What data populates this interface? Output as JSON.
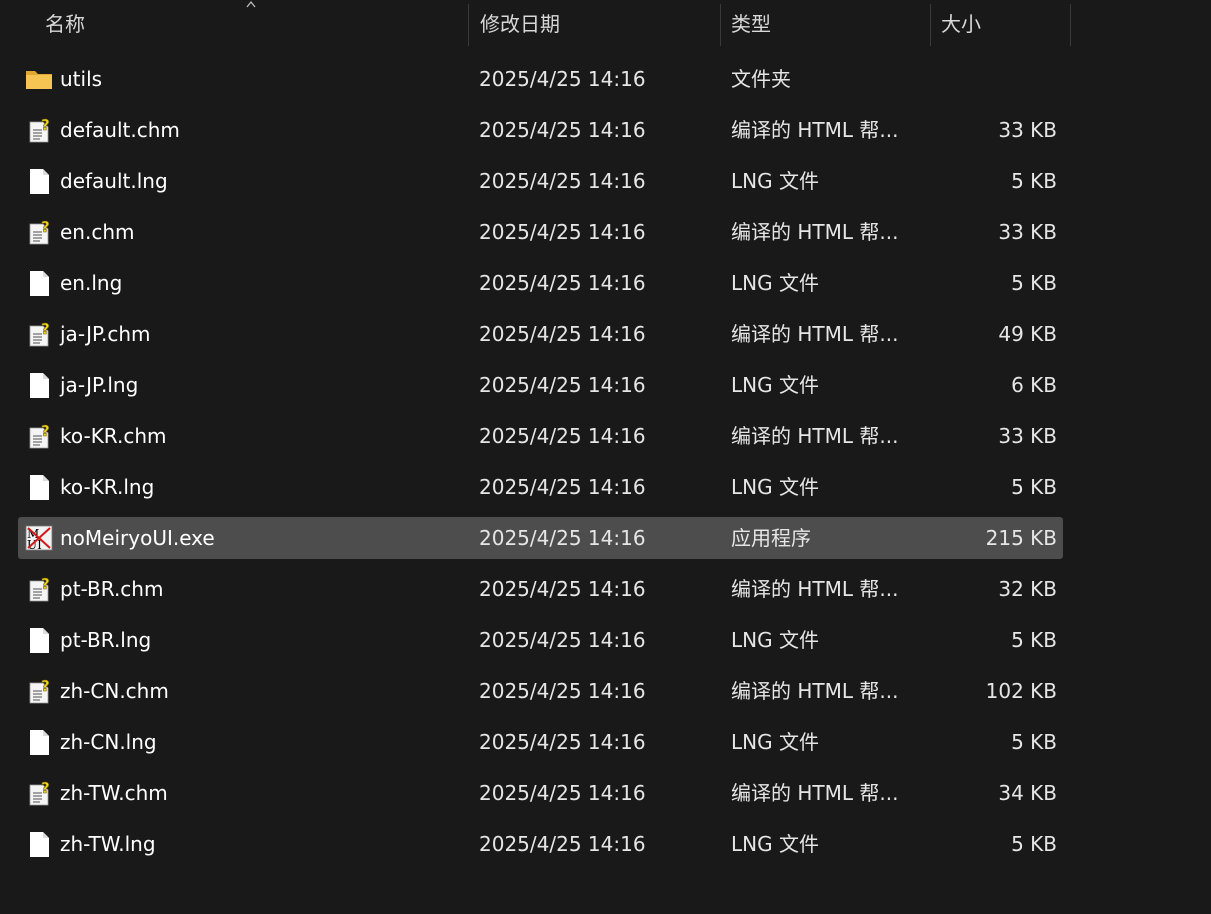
{
  "header": {
    "name": "名称",
    "date": "修改日期",
    "type": "类型",
    "size": "大小"
  },
  "colors": {
    "background": "#191919",
    "selected_row": "#4d4d4d",
    "folder": "#f2c14e",
    "help_badge": "#f7d51d"
  },
  "files": [
    {
      "name": "utils",
      "date": "2025/4/25 14:16",
      "type": "文件夹",
      "size": "",
      "icon": "folder-icon",
      "selected": false
    },
    {
      "name": "default.chm",
      "date": "2025/4/25 14:16",
      "type": "编译的 HTML 帮...",
      "size": "33 KB",
      "icon": "chm-help-icon",
      "selected": false
    },
    {
      "name": "default.lng",
      "date": "2025/4/25 14:16",
      "type": "LNG 文件",
      "size": "5 KB",
      "icon": "blank-file-icon",
      "selected": false
    },
    {
      "name": "en.chm",
      "date": "2025/4/25 14:16",
      "type": "编译的 HTML 帮...",
      "size": "33 KB",
      "icon": "chm-help-icon",
      "selected": false
    },
    {
      "name": "en.lng",
      "date": "2025/4/25 14:16",
      "type": "LNG 文件",
      "size": "5 KB",
      "icon": "blank-file-icon",
      "selected": false
    },
    {
      "name": "ja-JP.chm",
      "date": "2025/4/25 14:16",
      "type": "编译的 HTML 帮...",
      "size": "49 KB",
      "icon": "chm-help-icon",
      "selected": false
    },
    {
      "name": "ja-JP.lng",
      "date": "2025/4/25 14:16",
      "type": "LNG 文件",
      "size": "6 KB",
      "icon": "blank-file-icon",
      "selected": false
    },
    {
      "name": "ko-KR.chm",
      "date": "2025/4/25 14:16",
      "type": "编译的 HTML 帮...",
      "size": "33 KB",
      "icon": "chm-help-icon",
      "selected": false
    },
    {
      "name": "ko-KR.lng",
      "date": "2025/4/25 14:16",
      "type": "LNG 文件",
      "size": "5 KB",
      "icon": "blank-file-icon",
      "selected": false
    },
    {
      "name": "noMeiryoUI.exe",
      "date": "2025/4/25 14:16",
      "type": "应用程序",
      "size": "215 KB",
      "icon": "app-exe-icon",
      "selected": true
    },
    {
      "name": "pt-BR.chm",
      "date": "2025/4/25 14:16",
      "type": "编译的 HTML 帮...",
      "size": "32 KB",
      "icon": "chm-help-icon",
      "selected": false
    },
    {
      "name": "pt-BR.lng",
      "date": "2025/4/25 14:16",
      "type": "LNG 文件",
      "size": "5 KB",
      "icon": "blank-file-icon",
      "selected": false
    },
    {
      "name": "zh-CN.chm",
      "date": "2025/4/25 14:16",
      "type": "编译的 HTML 帮...",
      "size": "102 KB",
      "icon": "chm-help-icon",
      "selected": false
    },
    {
      "name": "zh-CN.lng",
      "date": "2025/4/25 14:16",
      "type": "LNG 文件",
      "size": "5 KB",
      "icon": "blank-file-icon",
      "selected": false
    },
    {
      "name": "zh-TW.chm",
      "date": "2025/4/25 14:16",
      "type": "编译的 HTML 帮...",
      "size": "34 KB",
      "icon": "chm-help-icon",
      "selected": false
    },
    {
      "name": "zh-TW.lng",
      "date": "2025/4/25 14:16",
      "type": "LNG 文件",
      "size": "5 KB",
      "icon": "blank-file-icon",
      "selected": false
    }
  ]
}
